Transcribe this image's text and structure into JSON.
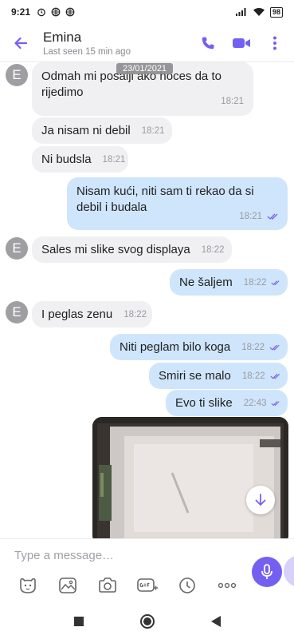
{
  "status_bar": {
    "time": "9:21",
    "battery": "98"
  },
  "header": {
    "contact_name": "Emina",
    "last_seen": "Last seen 15 min ago"
  },
  "chat": {
    "date_separator": "23/01/2021",
    "avatar_letter": "E",
    "messages": [
      {
        "dir": "in",
        "text_line1": "Odmah mi posalji ako hoces da to",
        "text_line2": "rijedimo",
        "time": "18:21"
      },
      {
        "dir": "in",
        "text": "Ja nisam ni debil",
        "time": "18:21"
      },
      {
        "dir": "in",
        "text": "Ni budsla",
        "time": "18:21"
      },
      {
        "dir": "out",
        "text_line1": "Nisam kući, niti sam ti rekao da si",
        "text_line2": "debil i budala",
        "time": "18:21"
      },
      {
        "dir": "in",
        "text": "Sales mi slike svog displaya",
        "time": "18:22"
      },
      {
        "dir": "out",
        "text": "Ne šaljem",
        "time": "18:22"
      },
      {
        "dir": "in",
        "text": "I peglas zenu",
        "time": "18:22"
      },
      {
        "dir": "out",
        "text": "Niti peglam bilo koga",
        "time": "18:22"
      },
      {
        "dir": "out",
        "text": "Smiri se malo",
        "time": "18:22"
      },
      {
        "dir": "out",
        "text": "Evo ti slike",
        "time": "22:43"
      }
    ]
  },
  "composer": {
    "placeholder": "Type a message…"
  },
  "colors": {
    "accent": "#7360f2",
    "incoming_bubble": "#f0f0f2",
    "outgoing_bubble": "#cfe5fb",
    "read_ticks": "#7360f2"
  },
  "icons": [
    "back-arrow-icon",
    "phone-icon",
    "video-icon",
    "more-vertical-icon",
    "sticker-icon",
    "gallery-icon",
    "camera-icon",
    "gif-icon",
    "clock-icon",
    "more-horizontal-icon",
    "mic-icon",
    "scroll-down-icon"
  ]
}
